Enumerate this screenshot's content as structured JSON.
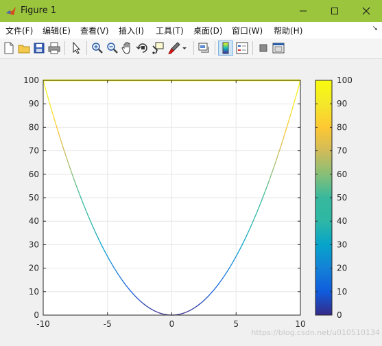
{
  "window": {
    "title": "Figure 1"
  },
  "menu": [
    {
      "label": "文件(F)"
    },
    {
      "label": "编辑(E)"
    },
    {
      "label": "查看(V)"
    },
    {
      "label": "插入(I)"
    },
    {
      "label": "工具(T)"
    },
    {
      "label": "桌面(D)"
    },
    {
      "label": "窗口(W)"
    },
    {
      "label": "帮助(H)"
    }
  ],
  "toolbar": {
    "buttons": [
      "new-figure",
      "open-file",
      "save-figure",
      "print-figure",
      "edit-plot",
      "zoom-in",
      "zoom-out",
      "pan",
      "rotate-3d",
      "data-cursor",
      "brush",
      "link-plot",
      "insert-colorbar",
      "insert-legend",
      "hide-plot-tools",
      "show-plot-tools"
    ],
    "active": "insert-colorbar"
  },
  "chart_data": {
    "type": "line",
    "title": "",
    "xlabel": "",
    "ylabel": "",
    "xlim": [
      -10,
      10
    ],
    "ylim": [
      0,
      100
    ],
    "grid": true,
    "x_ticks": [
      -10,
      -5,
      0,
      5,
      10
    ],
    "y_ticks": [
      0,
      10,
      20,
      30,
      40,
      50,
      60,
      70,
      80,
      90,
      100
    ],
    "series": [
      {
        "function": "y = x^2",
        "x_range": [
          -10,
          10
        ],
        "color_by": "y",
        "colormap": "parula"
      },
      {
        "x": [
          -10,
          10
        ],
        "y": [
          100,
          100
        ],
        "color_by": "y",
        "colormap": "parula"
      }
    ],
    "colorbar": {
      "range": [
        0,
        100
      ],
      "ticks": [
        0,
        10,
        20,
        30,
        40,
        50,
        60,
        70,
        80,
        90,
        100
      ],
      "colormap": "parula"
    }
  },
  "watermark": {
    "text": "https://blog.csdn.net/u010510134"
  },
  "colors": {
    "titlebar": "#9bc53d",
    "axes_bg": "#ffffff",
    "grid": "#e6e6e6"
  }
}
